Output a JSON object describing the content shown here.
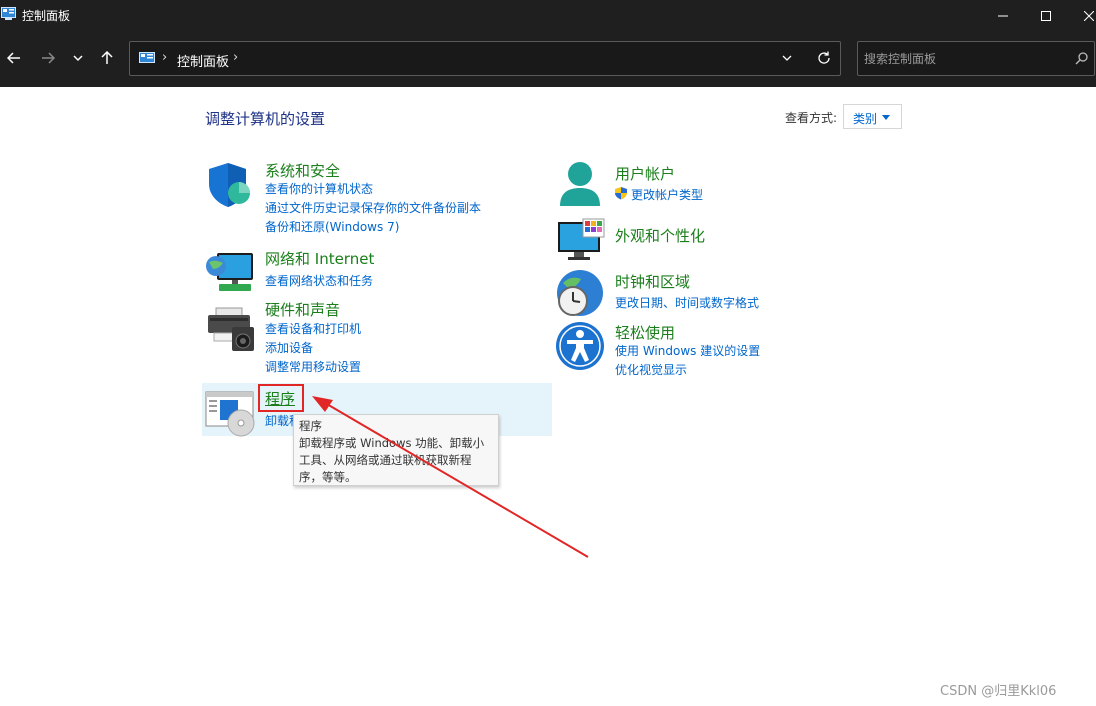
{
  "window": {
    "title": "控制面板",
    "controls": [
      "minimize-icon",
      "maximize-icon",
      "close-icon"
    ]
  },
  "navigation": {
    "buttons": [
      "back-arrow-icon",
      "forward-arrow-icon",
      "history-dropdown-icon",
      "up-arrow-icon"
    ],
    "address": {
      "separator": "›",
      "path": "控制面板"
    },
    "search": {
      "placeholder": "搜索控制面板"
    }
  },
  "main": {
    "heading": "调整计算机的设置",
    "view_by": {
      "label": "查看方式:",
      "value": "类别"
    }
  },
  "categories_left": [
    {
      "title": "系统和安全",
      "icon": "shield-icon",
      "links": [
        "查看你的计算机状态",
        "通过文件历史记录保存你的文件备份副本",
        "备份和还原(Windows 7)"
      ]
    },
    {
      "title": "网络和 Internet",
      "icon": "network-globe-icon",
      "links": [
        "查看网络状态和任务"
      ]
    },
    {
      "title": "硬件和声音",
      "icon": "printer-speaker-icon",
      "links": [
        "查看设备和打印机",
        "添加设备",
        "调整常用移动设置"
      ]
    },
    {
      "title": "程序",
      "icon": "programs-disc-icon",
      "links": [
        "卸载程序"
      ]
    }
  ],
  "categories_right": [
    {
      "title": "用户帐户",
      "icon": "user-icon",
      "links": [
        "更改帐户类型"
      ]
    },
    {
      "title": "外观和个性化",
      "icon": "monitor-palette-icon",
      "links": []
    },
    {
      "title": "时钟和区域",
      "icon": "clock-globe-icon",
      "links": [
        "更改日期、时间或数字格式"
      ]
    },
    {
      "title": "轻松使用",
      "icon": "accessibility-icon",
      "links": [
        "使用 Windows 建议的设置",
        "优化视觉显示"
      ]
    }
  ],
  "tooltip": {
    "title": "程序",
    "body": "卸载程序或 Windows 功能、卸载小工具、从网络或通过联机获取新程序，等等。"
  },
  "annotation": {
    "color": "#e22626"
  },
  "watermark": "CSDN @归里Kkl06",
  "colors": {
    "titlebar": "#1f1f1f",
    "category_title": "#1a7f1a",
    "link": "#0066cc",
    "heading": "#1e3287",
    "hover": "#e5f3fb"
  }
}
